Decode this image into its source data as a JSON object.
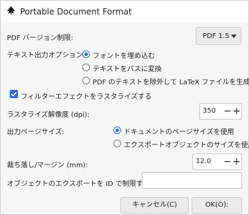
{
  "window": {
    "title": "Portable Document Format",
    "icon": "inkscape-icon"
  },
  "pdf_version": {
    "label": "PDF バージョン制限:",
    "value": "PDF 1.5"
  },
  "text_output": {
    "label": "テキスト出力オプション:",
    "options": [
      {
        "label": "フォントを埋め込む",
        "selected": true
      },
      {
        "label": "テキストをパスに変換",
        "selected": false
      },
      {
        "label": "PDF のテキストを除外して LaTeX ファイルを生成",
        "selected": false
      }
    ]
  },
  "rasterize_filter": {
    "label": "フィルターエフェクトをラスタライズする",
    "checked": true
  },
  "raster_dpi": {
    "label": "ラスタライズ解像度 (dpi):",
    "value": "350"
  },
  "page_size": {
    "label": "出力ページサイズ:",
    "options": [
      {
        "label": "ドキュメントのページサイズを使用",
        "selected": true
      },
      {
        "label": "エクスポートオブジェクトのサイズを使用",
        "selected": false
      }
    ]
  },
  "bleed": {
    "label": "裁ち落し/マージン (mm):",
    "value": "12.0"
  },
  "limit_id": {
    "label": "オブジェクトのエクスポートを ID で制限する:",
    "value": ""
  },
  "buttons": {
    "cancel": "キャンセル(C)",
    "ok": "OK(O):"
  },
  "colors": {
    "accent": "#2d6cdf"
  }
}
